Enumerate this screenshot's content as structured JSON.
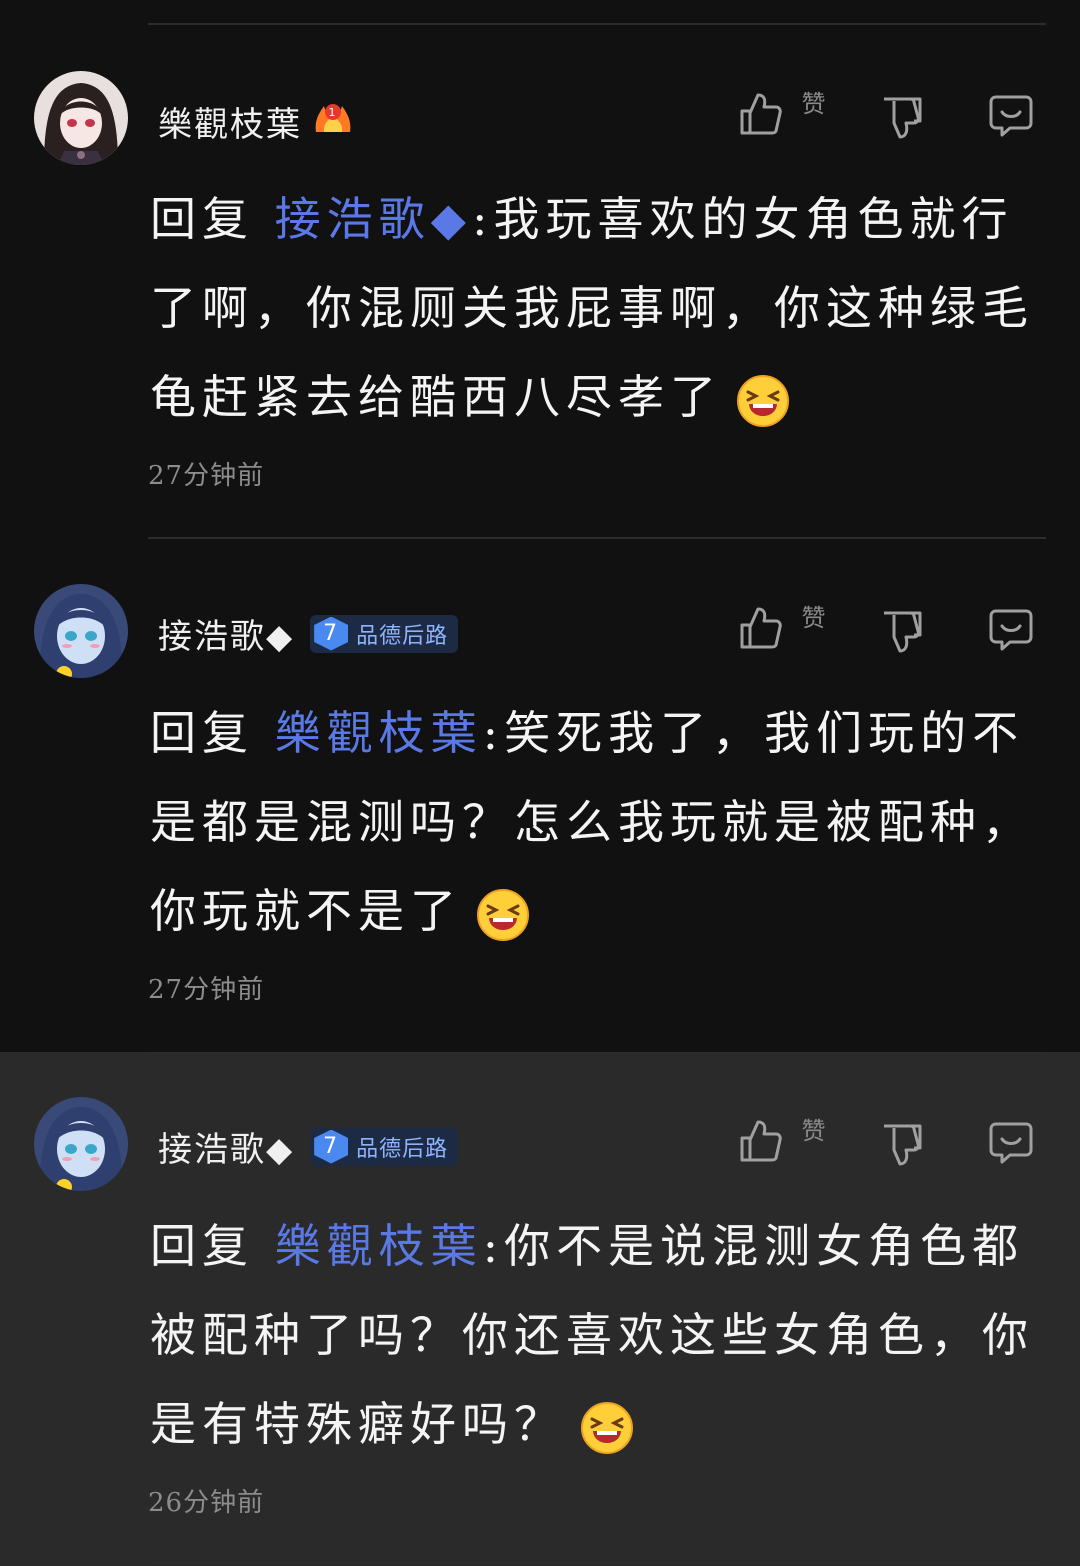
{
  "colors": {
    "background": "#111111",
    "highlight_bg": "#2a2a2a",
    "mention": "#5b79e6",
    "badge_level": "#4a8af0"
  },
  "comments": [
    {
      "username": "樂觀枝葉",
      "user_icon": "flame-badge-icon",
      "actions": {
        "like_label": "赞",
        "like_icon": "thumbs-up-icon",
        "dislike_icon": "thumbs-down-icon",
        "reply_icon": "reply-bubble-icon"
      },
      "reply_prefix": "回复",
      "mention": "接浩歌◆",
      "text": ":我玩喜欢的女角色就行了啊，你混厕关我屁事啊，你这种绿毛龟赶紧去给酷西八尽孝了",
      "emoji": "laughing-emoji-icon",
      "time": "27分钟前"
    },
    {
      "username": "接浩歌◆",
      "badge": {
        "level": "7",
        "title": "品德后路"
      },
      "actions": {
        "like_label": "赞",
        "like_icon": "thumbs-up-icon",
        "dislike_icon": "thumbs-down-icon",
        "reply_icon": "reply-bubble-icon"
      },
      "reply_prefix": "回复",
      "mention": "樂觀枝葉",
      "text": ":笑死我了，我们玩的不是都是混测吗？怎么我玩就是被配种，你玩就不是了",
      "emoji": "laughing-emoji-icon",
      "time": "27分钟前"
    },
    {
      "username": "接浩歌◆",
      "badge": {
        "level": "7",
        "title": "品德后路"
      },
      "actions": {
        "like_label": "赞",
        "like_icon": "thumbs-up-icon",
        "dislike_icon": "thumbs-down-icon",
        "reply_icon": "reply-bubble-icon"
      },
      "reply_prefix": "回复",
      "mention": "樂觀枝葉",
      "text": ":你不是说混测女角色都被配种了吗？你还喜欢这些女角色，你是有特殊癖好吗？",
      "emoji": "laughing-emoji-icon",
      "time": "26分钟前"
    }
  ]
}
